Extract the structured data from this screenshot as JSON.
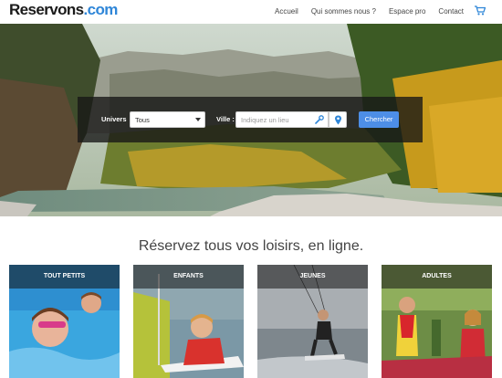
{
  "header": {
    "logo_dark": "Reservons",
    "logo_blue": ".com",
    "nav": [
      "Accueil",
      "Qui sommes nous ?",
      "Espace pro",
      "Contact"
    ],
    "cart_icon": "cart-icon"
  },
  "search": {
    "univers_label": "Univers",
    "univers_value": "Tous",
    "ville_label": "Ville :",
    "ville_placeholder": "Indiquez un lieu",
    "button_label": "Chercher",
    "button_color": "#4d8ee6"
  },
  "main": {
    "tagline": "Réservez tous vos loisirs, en ligne.",
    "categories": [
      "TOUT PETITS",
      "ENFANTS",
      "JEUNES",
      "ADULTES"
    ]
  },
  "colors": {
    "brand_blue": "#2f86d8",
    "brand_dark": "#1a1a1a"
  }
}
